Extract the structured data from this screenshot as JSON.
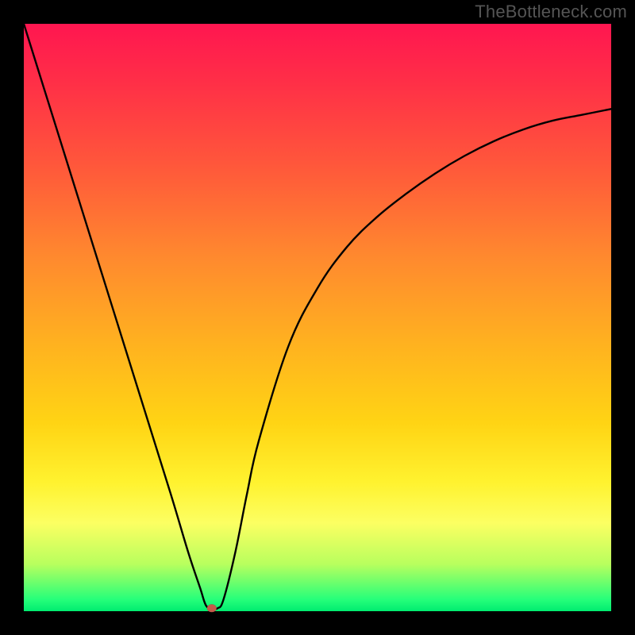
{
  "watermark": "TheBottleneck.com",
  "chart_data": {
    "type": "line",
    "title": "",
    "xlabel": "",
    "ylabel": "",
    "xlim": [
      0,
      100
    ],
    "ylim": [
      0,
      100
    ],
    "grid": false,
    "legend": false,
    "series": [
      {
        "name": "curve",
        "x": [
          0,
          5,
          10,
          15,
          20,
          25,
          28,
          30,
          31,
          32,
          33,
          34,
          36,
          38,
          40,
          45,
          50,
          55,
          60,
          65,
          70,
          75,
          80,
          85,
          90,
          95,
          100
        ],
        "y": [
          100,
          84,
          68,
          52,
          36,
          20,
          10,
          4,
          1,
          0.5,
          0.5,
          2,
          10,
          20,
          29,
          45,
          55,
          62,
          67,
          71,
          74.5,
          77.5,
          80,
          82,
          83.5,
          84.5,
          85.5
        ]
      }
    ],
    "marker": {
      "x": 32,
      "y": 0.5,
      "color": "#c45a4a"
    },
    "background_gradient": {
      "direction": "vertical",
      "stops": [
        {
          "pos": 0.0,
          "color": "#ff1650"
        },
        {
          "pos": 0.25,
          "color": "#ff5a3a"
        },
        {
          "pos": 0.55,
          "color": "#ffb31f"
        },
        {
          "pos": 0.78,
          "color": "#fff22f"
        },
        {
          "pos": 0.92,
          "color": "#b8ff5e"
        },
        {
          "pos": 1.0,
          "color": "#00ec70"
        }
      ]
    }
  }
}
